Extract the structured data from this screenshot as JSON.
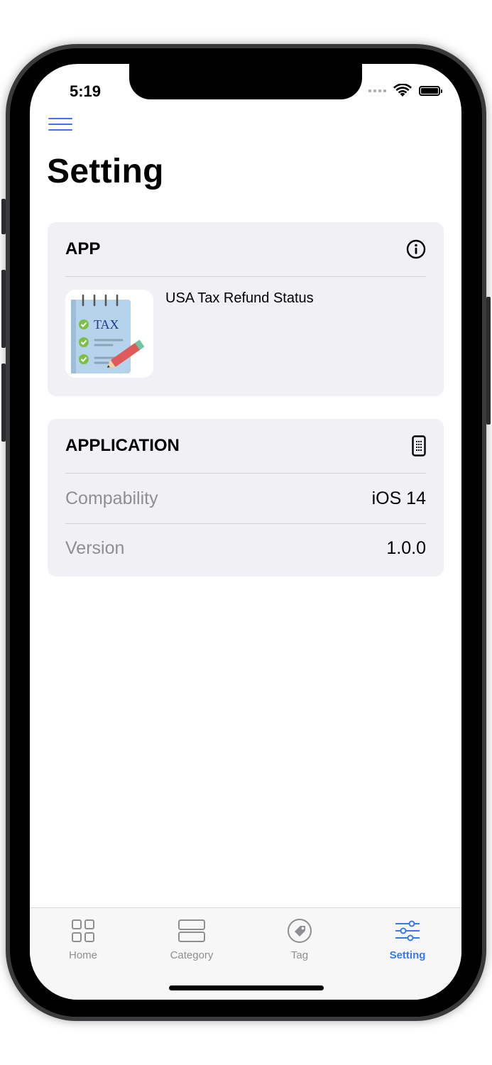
{
  "status_bar": {
    "time": "5:19"
  },
  "nav": {
    "title": "Setting"
  },
  "app_section": {
    "header": "APP",
    "app_name": "USA Tax Refund Status",
    "icon_text": "TAX"
  },
  "application_section": {
    "header": "APPLICATION",
    "rows": [
      {
        "label": "Compability",
        "value": "iOS 14"
      },
      {
        "label": "Version",
        "value": "1.0.0"
      }
    ]
  },
  "tabbar": {
    "items": [
      {
        "label": "Home",
        "icon": "grid-icon",
        "active": false
      },
      {
        "label": "Category",
        "icon": "rows-icon",
        "active": false
      },
      {
        "label": "Tag",
        "icon": "tag-icon",
        "active": false
      },
      {
        "label": "Setting",
        "icon": "sliders-icon",
        "active": true
      }
    ]
  },
  "colors": {
    "accent": "#3478f6",
    "card_bg": "#f0f0f5",
    "secondary_text": "#8e8e93"
  }
}
